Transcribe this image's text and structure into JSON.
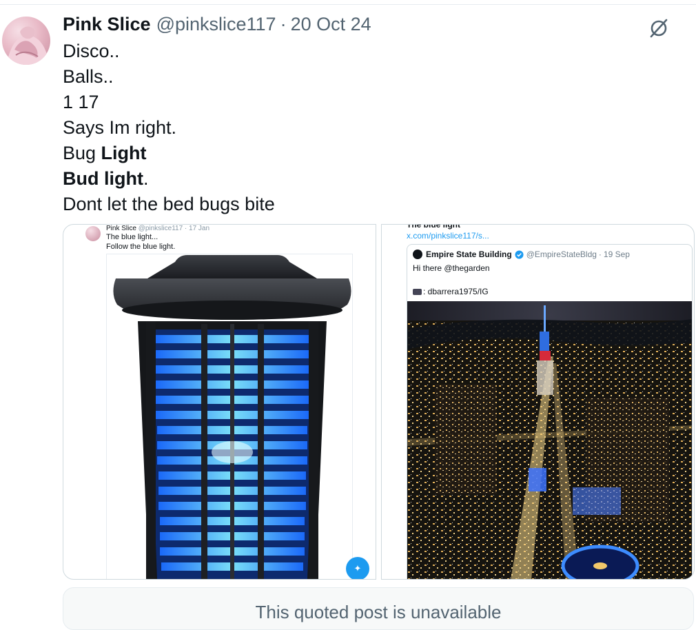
{
  "post": {
    "author_name": "Pink Slice",
    "author_handle": "@pinkslice117",
    "separator": "·",
    "date": "20 Oct 24",
    "lines": [
      "Disco..",
      "Balls..",
      "1 17",
      "Says Im right."
    ],
    "line_bug_prefix": "Bug ",
    "line_bug_bold": "Light",
    "line_bud_bold": "Bud light",
    "line_bud_suffix": ".",
    "line_last": "Dont let the bed bugs bite"
  },
  "media_left": {
    "author_name": "Pink Slice",
    "author_meta": "@pinkslice117 · 17 Jan",
    "text_1": "The blue light...",
    "text_2": "Follow the blue light.",
    "badge_icon": "grok-icon"
  },
  "media_right": {
    "top_text": "The blue light",
    "link": "x.com/pinkslice117/s...",
    "quoted": {
      "name": "Empire State Building",
      "handle": "@EmpireStateBldg",
      "separator": "·",
      "date": "19 Sep",
      "text": "Hi there @thegarden",
      "credit": ": dbarrera1975/IG"
    }
  },
  "quoted_unavailable": "This quoted post is unavailable",
  "colors": {
    "text": "#0f1419",
    "muted": "#536471",
    "accent": "#1d9bf0",
    "border": "#cfd9de"
  },
  "icons": {
    "top_right": "grok-icon",
    "verified": "verified-badge-icon"
  }
}
